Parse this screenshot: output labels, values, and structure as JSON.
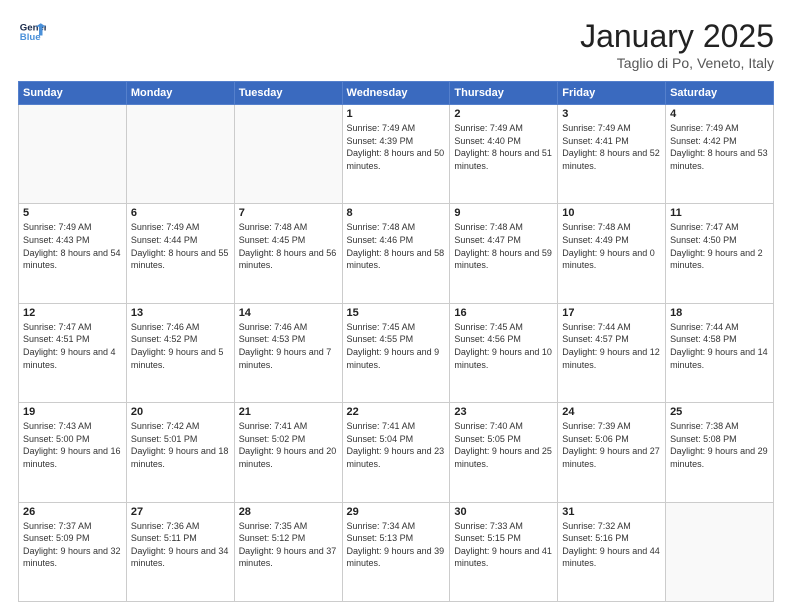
{
  "logo": {
    "line1": "General",
    "line2": "Blue"
  },
  "title": "January 2025",
  "subtitle": "Taglio di Po, Veneto, Italy",
  "weekdays": [
    "Sunday",
    "Monday",
    "Tuesday",
    "Wednesday",
    "Thursday",
    "Friday",
    "Saturday"
  ],
  "weeks": [
    [
      {
        "day": "",
        "info": ""
      },
      {
        "day": "",
        "info": ""
      },
      {
        "day": "",
        "info": ""
      },
      {
        "day": "1",
        "info": "Sunrise: 7:49 AM\nSunset: 4:39 PM\nDaylight: 8 hours\nand 50 minutes."
      },
      {
        "day": "2",
        "info": "Sunrise: 7:49 AM\nSunset: 4:40 PM\nDaylight: 8 hours\nand 51 minutes."
      },
      {
        "day": "3",
        "info": "Sunrise: 7:49 AM\nSunset: 4:41 PM\nDaylight: 8 hours\nand 52 minutes."
      },
      {
        "day": "4",
        "info": "Sunrise: 7:49 AM\nSunset: 4:42 PM\nDaylight: 8 hours\nand 53 minutes."
      }
    ],
    [
      {
        "day": "5",
        "info": "Sunrise: 7:49 AM\nSunset: 4:43 PM\nDaylight: 8 hours\nand 54 minutes."
      },
      {
        "day": "6",
        "info": "Sunrise: 7:49 AM\nSunset: 4:44 PM\nDaylight: 8 hours\nand 55 minutes."
      },
      {
        "day": "7",
        "info": "Sunrise: 7:48 AM\nSunset: 4:45 PM\nDaylight: 8 hours\nand 56 minutes."
      },
      {
        "day": "8",
        "info": "Sunrise: 7:48 AM\nSunset: 4:46 PM\nDaylight: 8 hours\nand 58 minutes."
      },
      {
        "day": "9",
        "info": "Sunrise: 7:48 AM\nSunset: 4:47 PM\nDaylight: 8 hours\nand 59 minutes."
      },
      {
        "day": "10",
        "info": "Sunrise: 7:48 AM\nSunset: 4:49 PM\nDaylight: 9 hours\nand 0 minutes."
      },
      {
        "day": "11",
        "info": "Sunrise: 7:47 AM\nSunset: 4:50 PM\nDaylight: 9 hours\nand 2 minutes."
      }
    ],
    [
      {
        "day": "12",
        "info": "Sunrise: 7:47 AM\nSunset: 4:51 PM\nDaylight: 9 hours\nand 4 minutes."
      },
      {
        "day": "13",
        "info": "Sunrise: 7:46 AM\nSunset: 4:52 PM\nDaylight: 9 hours\nand 5 minutes."
      },
      {
        "day": "14",
        "info": "Sunrise: 7:46 AM\nSunset: 4:53 PM\nDaylight: 9 hours\nand 7 minutes."
      },
      {
        "day": "15",
        "info": "Sunrise: 7:45 AM\nSunset: 4:55 PM\nDaylight: 9 hours\nand 9 minutes."
      },
      {
        "day": "16",
        "info": "Sunrise: 7:45 AM\nSunset: 4:56 PM\nDaylight: 9 hours\nand 10 minutes."
      },
      {
        "day": "17",
        "info": "Sunrise: 7:44 AM\nSunset: 4:57 PM\nDaylight: 9 hours\nand 12 minutes."
      },
      {
        "day": "18",
        "info": "Sunrise: 7:44 AM\nSunset: 4:58 PM\nDaylight: 9 hours\nand 14 minutes."
      }
    ],
    [
      {
        "day": "19",
        "info": "Sunrise: 7:43 AM\nSunset: 5:00 PM\nDaylight: 9 hours\nand 16 minutes."
      },
      {
        "day": "20",
        "info": "Sunrise: 7:42 AM\nSunset: 5:01 PM\nDaylight: 9 hours\nand 18 minutes."
      },
      {
        "day": "21",
        "info": "Sunrise: 7:41 AM\nSunset: 5:02 PM\nDaylight: 9 hours\nand 20 minutes."
      },
      {
        "day": "22",
        "info": "Sunrise: 7:41 AM\nSunset: 5:04 PM\nDaylight: 9 hours\nand 23 minutes."
      },
      {
        "day": "23",
        "info": "Sunrise: 7:40 AM\nSunset: 5:05 PM\nDaylight: 9 hours\nand 25 minutes."
      },
      {
        "day": "24",
        "info": "Sunrise: 7:39 AM\nSunset: 5:06 PM\nDaylight: 9 hours\nand 27 minutes."
      },
      {
        "day": "25",
        "info": "Sunrise: 7:38 AM\nSunset: 5:08 PM\nDaylight: 9 hours\nand 29 minutes."
      }
    ],
    [
      {
        "day": "26",
        "info": "Sunrise: 7:37 AM\nSunset: 5:09 PM\nDaylight: 9 hours\nand 32 minutes."
      },
      {
        "day": "27",
        "info": "Sunrise: 7:36 AM\nSunset: 5:11 PM\nDaylight: 9 hours\nand 34 minutes."
      },
      {
        "day": "28",
        "info": "Sunrise: 7:35 AM\nSunset: 5:12 PM\nDaylight: 9 hours\nand 37 minutes."
      },
      {
        "day": "29",
        "info": "Sunrise: 7:34 AM\nSunset: 5:13 PM\nDaylight: 9 hours\nand 39 minutes."
      },
      {
        "day": "30",
        "info": "Sunrise: 7:33 AM\nSunset: 5:15 PM\nDaylight: 9 hours\nand 41 minutes."
      },
      {
        "day": "31",
        "info": "Sunrise: 7:32 AM\nSunset: 5:16 PM\nDaylight: 9 hours\nand 44 minutes."
      },
      {
        "day": "",
        "info": ""
      }
    ]
  ]
}
